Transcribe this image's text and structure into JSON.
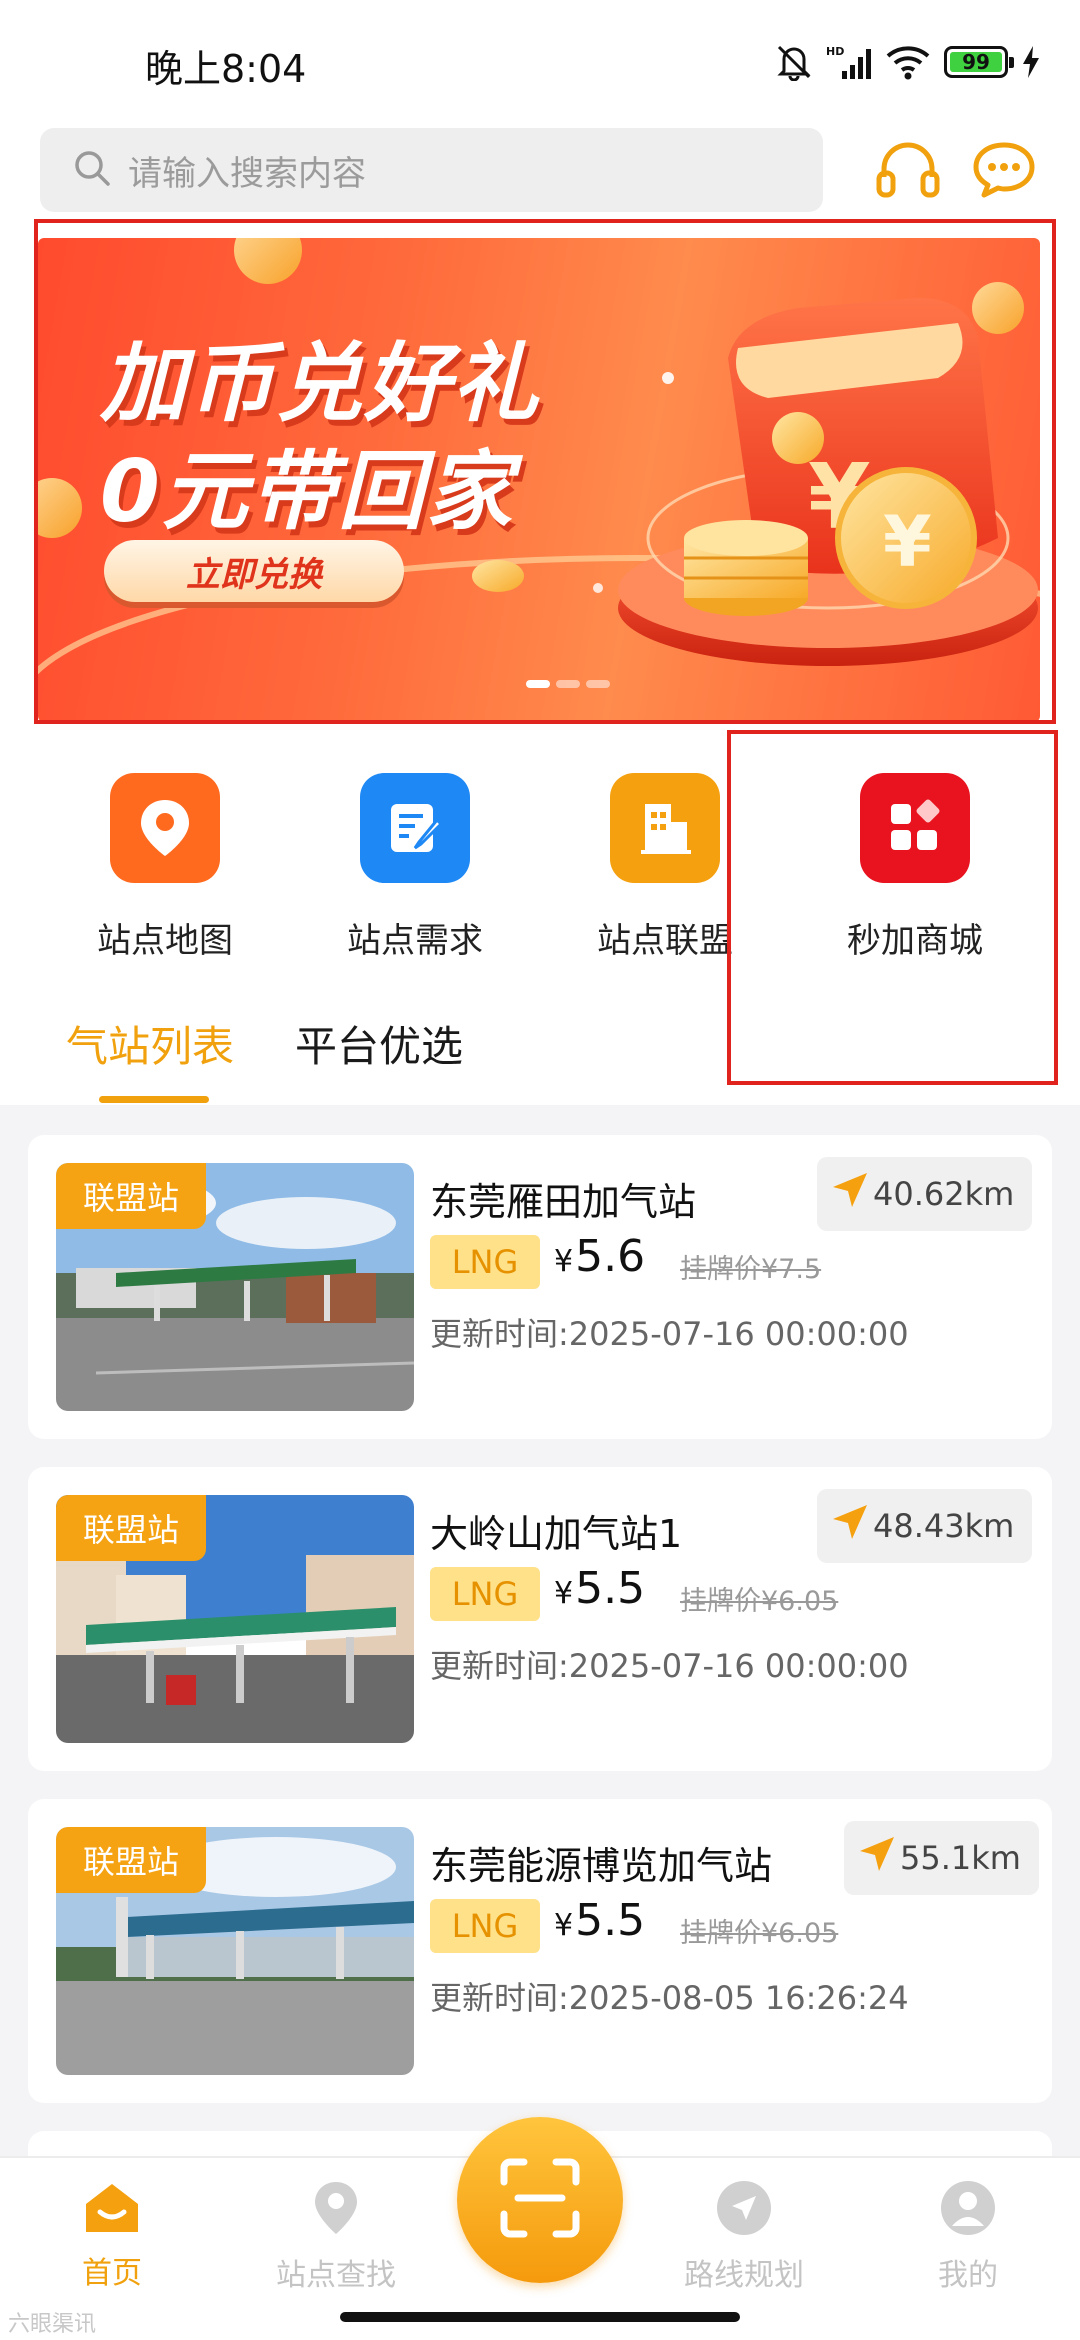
{
  "status_bar": {
    "time": "晚上8:04",
    "battery": "99"
  },
  "search": {
    "placeholder": "请输入搜索内容"
  },
  "banner": {
    "line1": "加币兑好礼",
    "line2": "0元带回家",
    "button": "立即兑换",
    "page_count": 3,
    "active_page": 1
  },
  "menu": {
    "items": [
      {
        "label": "站点地图",
        "icon": "location-pin-icon",
        "color": "#ff6a1f"
      },
      {
        "label": "站点需求",
        "icon": "edit-document-icon",
        "color": "#1e88f5"
      },
      {
        "label": "站点联盟",
        "icon": "building-icon",
        "color": "#f5a00e"
      },
      {
        "label": "秒加商城",
        "icon": "app-grid-icon",
        "color": "#e8131f"
      }
    ]
  },
  "tabs": [
    {
      "label": "气站列表",
      "active": true
    },
    {
      "label": "平台优选",
      "active": false
    }
  ],
  "stations": [
    {
      "tag": "联盟站",
      "name": "东莞雁田加气站",
      "distance": "40.62km",
      "fuel": "LNG",
      "currency": "¥",
      "price": "5.6",
      "list_price": "挂牌价¥7.5",
      "updated": "更新时间:2025-07-16 00:00:00"
    },
    {
      "tag": "联盟站",
      "name": "大岭山加气站1",
      "distance": "48.43km",
      "fuel": "LNG",
      "currency": "¥",
      "price": "5.5",
      "list_price": "挂牌价¥6.05",
      "updated": "更新时间:2025-07-16 00:00:00"
    },
    {
      "tag": "联盟站",
      "name": "东莞能源博览加气站",
      "distance": "55.1km",
      "fuel": "LNG",
      "currency": "¥",
      "price": "5.5",
      "list_price": "挂牌价¥6.05",
      "updated": "更新时间:2025-08-05 16:26:24"
    }
  ],
  "bottom_nav": [
    {
      "label": "首页",
      "icon": "home-icon",
      "active": true
    },
    {
      "label": "站点查找",
      "icon": "location-icon",
      "active": false
    },
    {
      "label": "路线规划",
      "icon": "navigation-icon",
      "active": false
    },
    {
      "label": "我的",
      "icon": "user-icon",
      "active": false
    }
  ],
  "scan": {
    "icon": "scan-icon"
  },
  "watermark": "六眼渠讯",
  "colors": {
    "accent": "#f0a10d",
    "highlight": "#e0231c"
  }
}
